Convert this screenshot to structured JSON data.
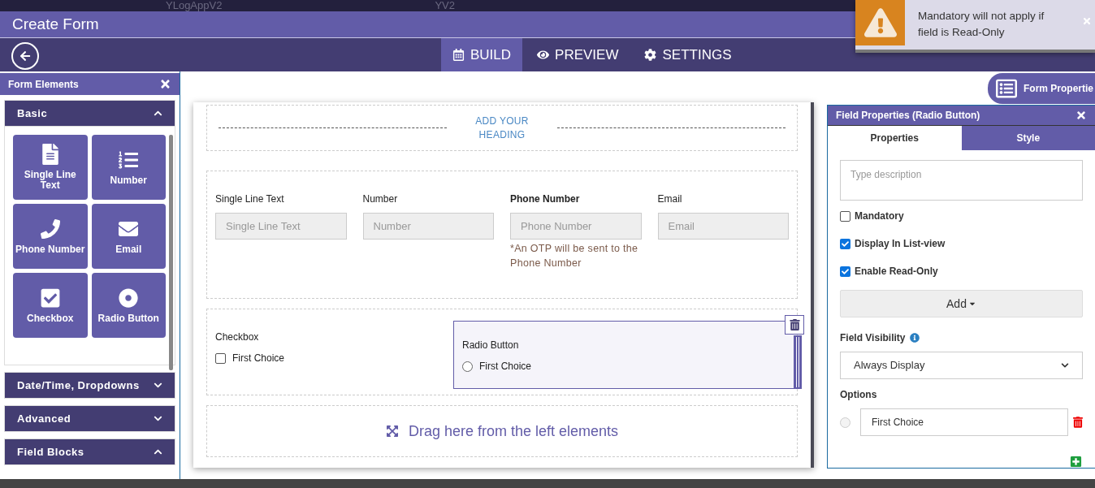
{
  "top_bar": {
    "app_name": "YLogAppV2",
    "center_text": "YV2"
  },
  "header": {
    "title": "Create Form"
  },
  "nav": {
    "tabs": [
      {
        "label": "BUILD",
        "selected": true
      },
      {
        "label": "PREVIEW",
        "selected": false
      },
      {
        "label": "SETTINGS",
        "selected": false
      }
    ]
  },
  "toast": {
    "message": "Mandatory will not apply if field is Read-Only"
  },
  "form_properties_button": "Form Propertie",
  "sidebar": {
    "title": "Form Elements",
    "sections": [
      {
        "label": "Basic",
        "expanded": true,
        "items": [
          {
            "label": "Single Line Text"
          },
          {
            "label": "Number"
          },
          {
            "label": "Phone Number"
          },
          {
            "label": "Email"
          },
          {
            "label": "Checkbox"
          },
          {
            "label": "Radio Button"
          }
        ]
      },
      {
        "label": "Date/Time, Dropdowns",
        "expanded": false
      },
      {
        "label": "Advanced",
        "expanded": false
      },
      {
        "label": "Field Blocks",
        "expanded": true
      }
    ]
  },
  "canvas": {
    "heading": "ADD YOUR HEADING",
    "text_fields": [
      {
        "label": "Single Line Text",
        "placeholder": "Single Line Text",
        "bold": false
      },
      {
        "label": "Number",
        "placeholder": "Number",
        "bold": false
      },
      {
        "label": "Phone Number",
        "placeholder": "Phone Number",
        "bold": true,
        "note": "*An OTP will be sent to the Phone Number"
      },
      {
        "label": "Email",
        "placeholder": "Email",
        "bold": false
      }
    ],
    "choice_fields": [
      {
        "kind": "checkbox",
        "label": "Checkbox",
        "selected": false,
        "options": [
          {
            "label": "First Choice",
            "checked": false
          }
        ]
      },
      {
        "kind": "radio",
        "label": "Radio Button",
        "selected": true,
        "options": [
          {
            "label": "First Choice",
            "checked": false
          }
        ]
      }
    ],
    "drop_zone": "Drag here from the left elements"
  },
  "field_properties": {
    "title": "Field Properties (Radio Button)",
    "tabs": [
      {
        "label": "Properties",
        "selected": true
      },
      {
        "label": "Style",
        "selected": false
      }
    ],
    "description_placeholder": "Type description",
    "checkboxes": [
      {
        "label": "Mandatory",
        "checked": false
      },
      {
        "label": "Display In List-view",
        "checked": true
      },
      {
        "label": "Enable Read-Only",
        "checked": true
      }
    ],
    "add_button": "Add",
    "visibility_label": "Field Visibility",
    "visibility_value": "Always Display",
    "options_label": "Options",
    "options": [
      {
        "value": "First Choice",
        "checked": false
      }
    ]
  }
}
